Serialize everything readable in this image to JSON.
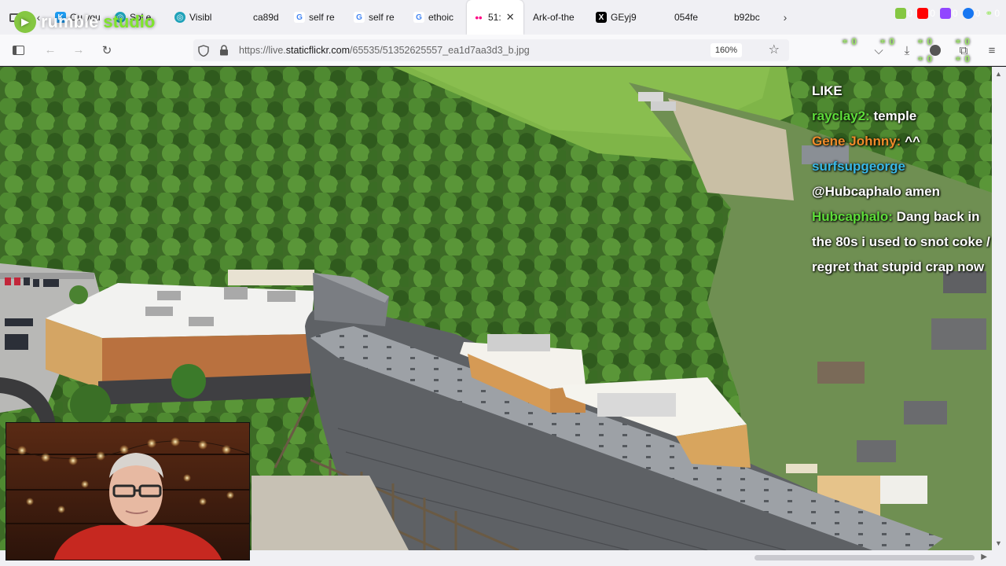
{
  "browser": {
    "tabs": [
      {
        "label": "",
        "fav_color": "#555555",
        "fav_glyph": "‹"
      },
      {
        "label": "Ou you",
        "fav_color": "#1d9bf0",
        "fav_glyph": "K"
      },
      {
        "label": "Sol e",
        "fav_color": "#1fa2b9",
        "fav_glyph": "◎"
      },
      {
        "label": "Visibl",
        "fav_color": "#1fa2b9",
        "fav_glyph": "◎"
      },
      {
        "label": "ca89d",
        "fav_color": "",
        "fav_glyph": ""
      },
      {
        "label": "self re",
        "fav_color": "#4285f4",
        "fav_glyph": "G"
      },
      {
        "label": "self re",
        "fav_color": "#4285f4",
        "fav_glyph": "G"
      },
      {
        "label": "ethoic",
        "fav_color": "#4285f4",
        "fav_glyph": "G"
      },
      {
        "label": "51:",
        "fav_color": "#ff0084",
        "fav_glyph": "••",
        "active": true
      },
      {
        "label": "Ark-of-the",
        "fav_color": "",
        "fav_glyph": ""
      },
      {
        "label": "GEyj9",
        "fav_color": "#000000",
        "fav_glyph": "X"
      },
      {
        "label": "054fe",
        "fav_color": "",
        "fav_glyph": ""
      },
      {
        "label": "b92bc",
        "fav_color": "",
        "fav_glyph": ""
      }
    ],
    "active_close": "✕",
    "url_prefix": "https://live.",
    "url_host": "staticflickr.com",
    "url_path": "/65535/51352625557_ea1d7aa3d3_b.jpg",
    "zoom": "160%"
  },
  "overlay": {
    "brand_word1": "rumble",
    "brand_word2": "studio",
    "social_counts": [
      "0",
      "0",
      "0",
      "0",
      "0"
    ],
    "link_counts": [
      "0",
      "0",
      "0",
      "0",
      "0",
      "0"
    ]
  },
  "chat": {
    "messages": [
      {
        "user": "",
        "text": "LIKE"
      },
      {
        "user": "rayclay2:",
        "text": " temple"
      },
      {
        "user": "Gene Johnny:",
        "text": " ^^"
      },
      {
        "user": "surfsupgeorge",
        "text": ""
      },
      {
        "user": "",
        "text": "@Hubcaphalo amen"
      },
      {
        "user": "Hubcaphalo:",
        "text": " Dang back in the 80s i used to snot coke / i regret that stupid crap now"
      }
    ]
  }
}
